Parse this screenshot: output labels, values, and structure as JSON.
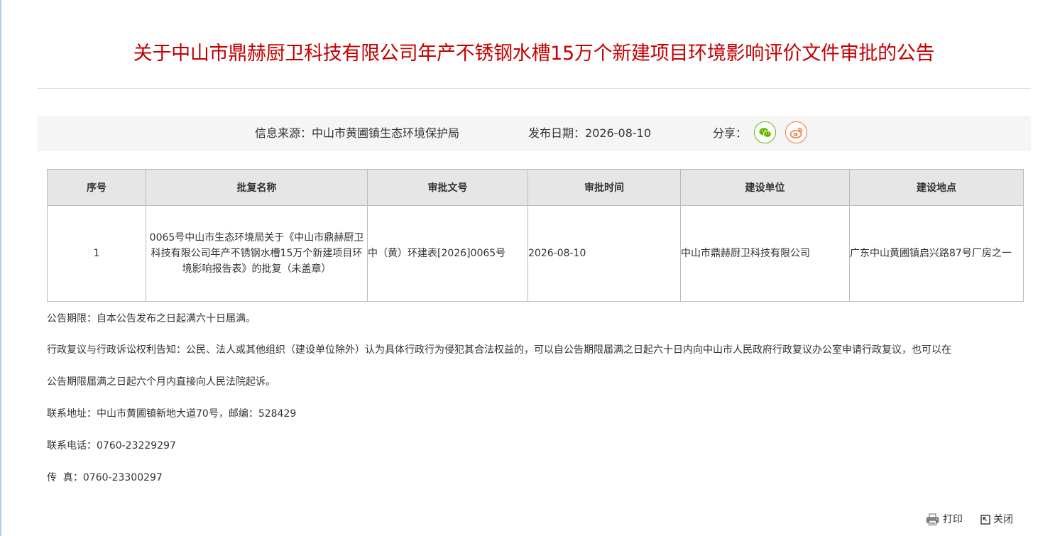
{
  "title": "关于中山市鼎赫厨卫科技有限公司年产不锈钢水槽15万个新建项目环境影响评价文件审批的公告",
  "info": {
    "source_label": "信息来源：",
    "source_value": "中山市黄圃镇生态环境保护局",
    "date_label": "发布日期：",
    "date_value": "2026-08-10",
    "share_label": "分享："
  },
  "table": {
    "headers": [
      "序号",
      "批复名称",
      "审批文号",
      "审批时间",
      "建设单位",
      "建设地点"
    ],
    "rows": [
      {
        "index": "1",
        "name": "0065号中山市生态环境局关于《中山市鼎赫厨卫科技有限公司年产不锈钢水槽15万个新建项目环境影响报告表》的批复（未盖章）",
        "doc_no": "中（黄）环建表[2026]0065号",
        "time": "2026-08-10",
        "unit": "中山市鼎赫厨卫科技有限公司",
        "location": "广东中山黄圃镇启兴路87号厂房之一"
      }
    ]
  },
  "notices": {
    "period": "公告期限：自本公告发布之日起满六十日届满。",
    "rights_line1": "行政复议与行政诉讼权利告知：公民、法人或其他组织（建设单位除外）认为具体行政行为侵犯其合法权益的，可以自公告期限届满之日起六十日内向中山市人民政府行政复议办公室申请行政复议，也可以在",
    "rights_line2": "公告期限届满之日起六个月内直接向人民法院起诉。",
    "address": "联系地址：中山市黄圃镇新地大道70号，邮编：528429",
    "phone": "联系电话：0760-23229297",
    "fax": "传  真：0760-23300297"
  },
  "actions": {
    "print": "打印",
    "close": "关闭"
  },
  "icons": {
    "wechat": "wechat-icon",
    "weibo": "weibo-icon",
    "print": "printer-icon",
    "close": "close-window-icon"
  },
  "colors": {
    "title": "#c40000",
    "wechat": "#62b900",
    "weibo": "#f07a3c"
  }
}
